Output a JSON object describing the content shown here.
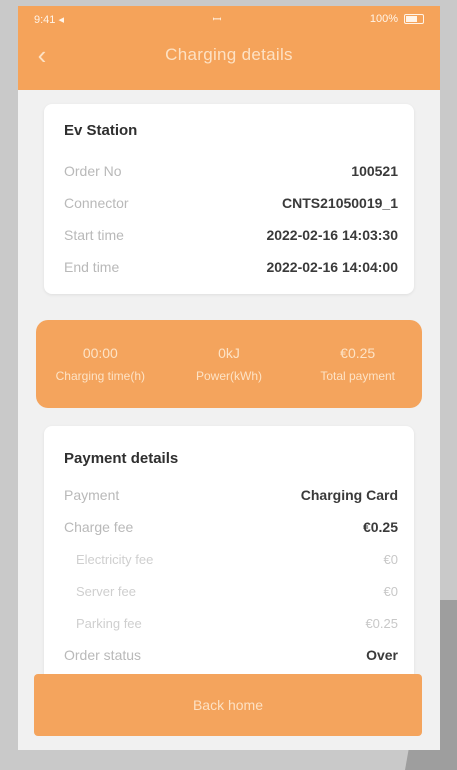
{
  "status_bar": {
    "time": "9:41 ◂",
    "carrier": "ꟷ",
    "battery": "100%"
  },
  "header": {
    "title": "Charging details"
  },
  "station": {
    "title": "Ev Station",
    "rows": [
      {
        "label": "Order No",
        "value": "100521"
      },
      {
        "label": "Connector",
        "value": "CNTS21050019_1"
      },
      {
        "label": "Start time",
        "value": "2022-02-16 14:03:30"
      },
      {
        "label": "End time",
        "value": "2022-02-16 14:04:00"
      }
    ]
  },
  "summary": [
    {
      "value": "00:00",
      "label": "Charging time(h)"
    },
    {
      "value": "0kJ",
      "label": "Power(kWh)"
    },
    {
      "value": "€0.25",
      "label": "Total payment"
    }
  ],
  "payment": {
    "title": "Payment details",
    "payment_label": "Payment",
    "payment_value": "Charging Card",
    "charge_fee_label": "Charge fee",
    "charge_fee_value": "€0.25",
    "electricity_label": "Electricity fee",
    "electricity_value": "€0",
    "server_label": "Server fee",
    "server_value": "€0",
    "parking_label": "Parking fee",
    "parking_value": "€0.25",
    "status_label": "Order status",
    "status_value": "Over"
  },
  "bottom_button": {
    "label": "Back home"
  },
  "colors": {
    "accent": "#f5a35a",
    "background": "#f1f1f1"
  }
}
